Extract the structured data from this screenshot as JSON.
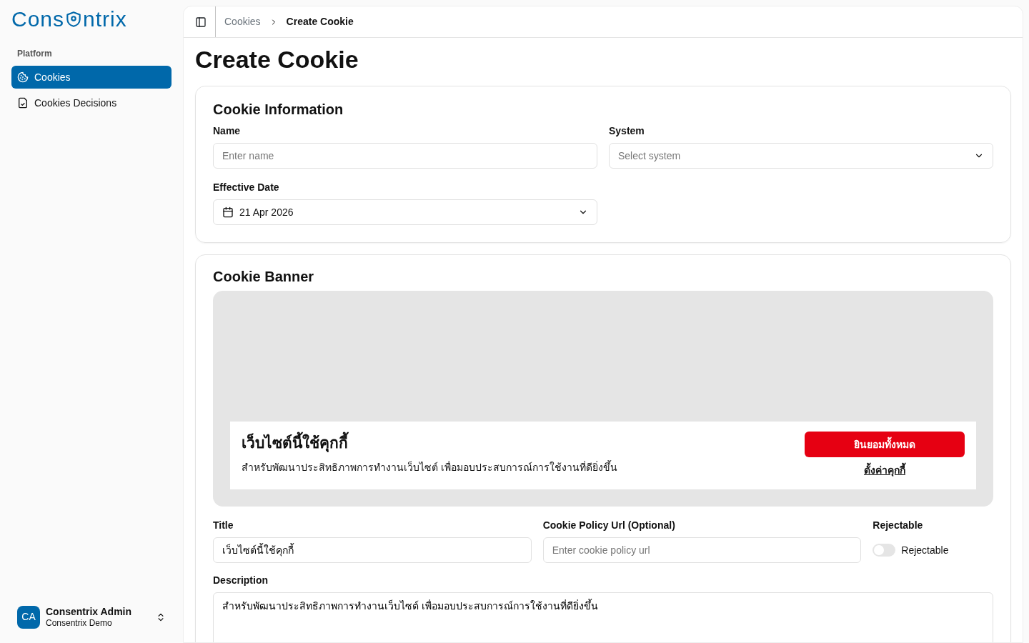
{
  "sidebar": {
    "logo": {
      "before": "Cons",
      "after": "ntrix"
    },
    "section": "Platform",
    "items": [
      {
        "label": "Cookies",
        "selected": true
      },
      {
        "label": "Cookies Decisions",
        "selected": false
      }
    ],
    "user": {
      "initials": "CA",
      "name": "Consentrix Admin",
      "org": "Consentrix Demo"
    }
  },
  "breadcrumb": [
    {
      "label": "Cookies",
      "current": false
    },
    {
      "label": "Create Cookie",
      "current": true
    }
  ],
  "page_title": "Create Cookie",
  "cookie_information": {
    "title": "Cookie Information",
    "name": {
      "label": "Name",
      "placeholder": "Enter name"
    },
    "system": {
      "label": "System",
      "placeholder": "Select system"
    },
    "effective_date": {
      "label": "Effective Date",
      "value": "21 Apr 2026"
    }
  },
  "cookie_banner": {
    "title": "Cookie Banner",
    "preview": {
      "title": "เว็บไซต์นี้ใช้คุกกี้",
      "description": "สำหรับพัฒนาประสิทธิภาพการทำงานเว็บไซต์ เพื่อมอบประสบการณ์การใช้งานที่ดียิ่งขึ้น",
      "accept_button": "ยินยอมทั้งหมด",
      "settings_link": "ตั้งค่าคุกกี้",
      "color": "#e60012"
    },
    "title_field": {
      "label": "Title",
      "value": "เว็บไซต์นี้ใช้คุกกี้"
    },
    "policy_url": {
      "label": "Cookie Policy Url (Optional)",
      "placeholder": "Enter cookie policy url"
    },
    "rejectable": {
      "label": "Rejectable",
      "switch_label": "Rejectable",
      "on": false
    },
    "description": {
      "label": "Description",
      "value": "สำหรับพัฒนาประสิทธิภาพการทำงานเว็บไซต์ เพื่อมอบประสบการณ์การใช้งานที่ดียิ่งขึ้น"
    }
  }
}
